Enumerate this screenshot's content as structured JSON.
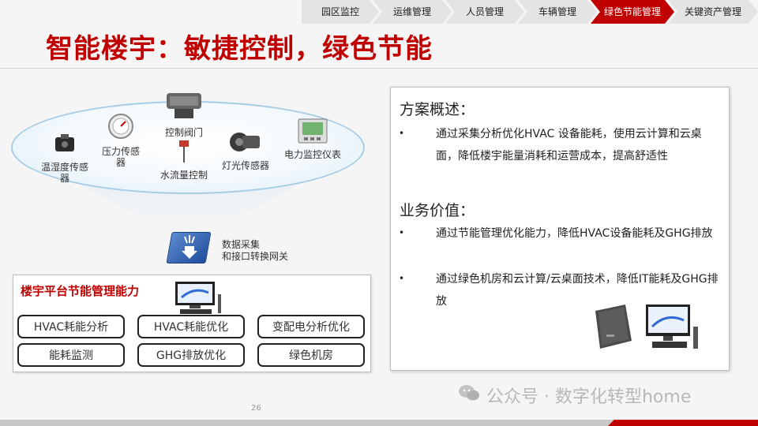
{
  "nav": {
    "items": [
      {
        "label": "园区监控",
        "active": false
      },
      {
        "label": "运维管理",
        "active": false
      },
      {
        "label": "人员管理",
        "active": false
      },
      {
        "label": "车辆管理",
        "active": false
      },
      {
        "label": "绿色节能管理",
        "active": true
      },
      {
        "label": "关键资产管理",
        "active": false
      }
    ]
  },
  "title": "智能楼宇：敏捷控制，绿色节能",
  "devices": {
    "temp": "温湿度传感器",
    "pressure": "压力传感器",
    "valve": "控制阀门",
    "flow": "水流量控制",
    "light": "灯光传感器",
    "meter": "电力监控仪表"
  },
  "gateway": {
    "line1": "数据采集",
    "line2": "和接口转换网关"
  },
  "capability": {
    "title": "楼宇平台节能管理能力",
    "buttons": [
      "HVAC耗能分析",
      "HVAC耗能优化",
      "变配电分析优化",
      "能耗监测",
      "GHG排放优化",
      "绿色机房"
    ]
  },
  "overview": {
    "heading1": "方案概述：",
    "summary": "通过采集分析优化HVAC 设备能耗，使用云计算和云桌面，降低楼宇能量消耗和运营成本，提高舒适性",
    "heading2": "业务价值：",
    "values": [
      "通过节能管理优化能力，降低HVAC设备能耗及GHG排放",
      "通过绿色机房和云计算/云桌面技术，降低IT能耗及GHG排放"
    ],
    "bullet": "•"
  },
  "page_number": "26",
  "watermark": "公众号 · 数字化转型home",
  "colors": {
    "accent": "#c00000",
    "nav_bg": "#e4e4e4"
  }
}
